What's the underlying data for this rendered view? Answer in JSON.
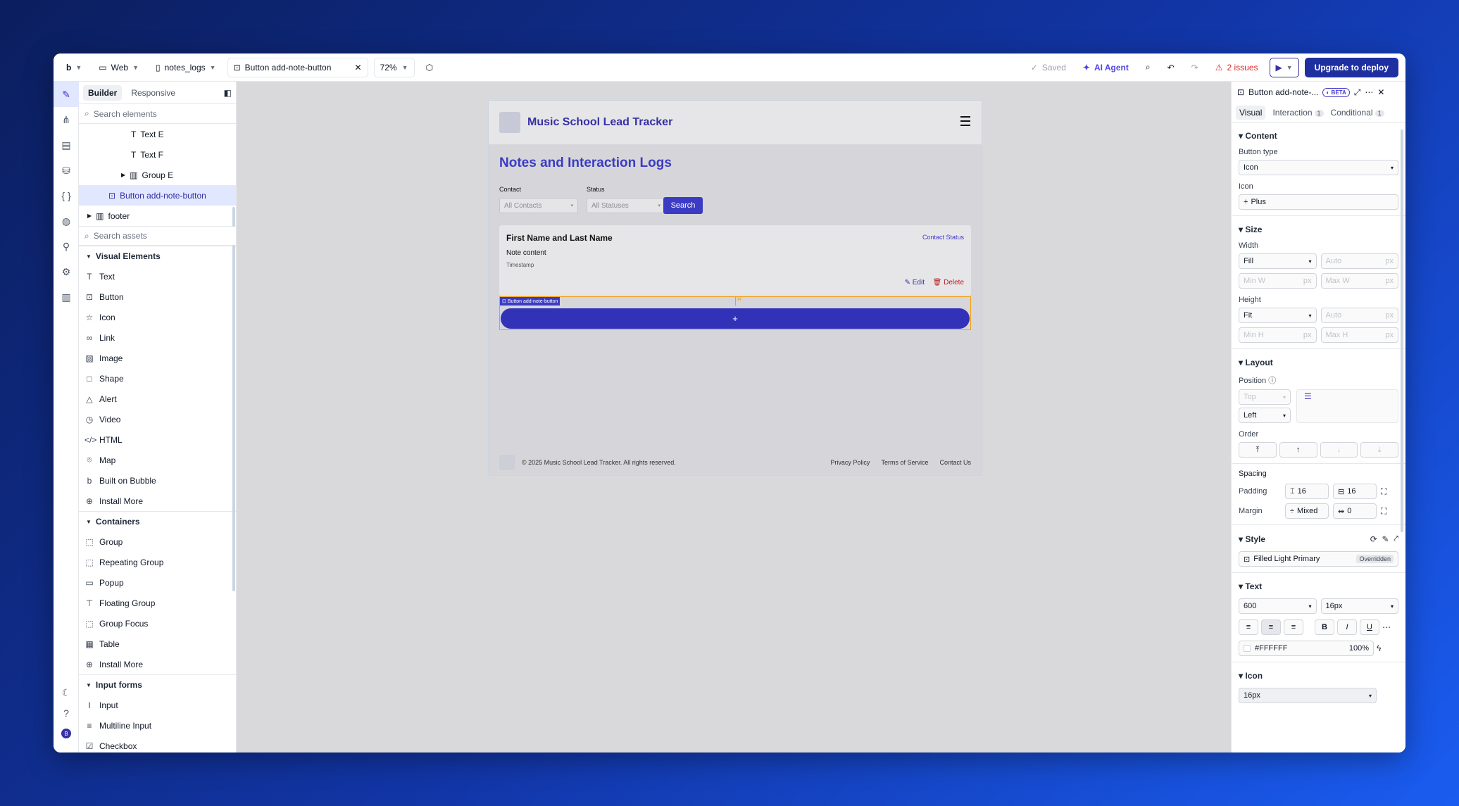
{
  "topbar": {
    "logo": "b",
    "platform": "Web",
    "page": "notes_logs",
    "element_tab": "Button add-note-button",
    "zoom": "72%",
    "saved": "Saved",
    "ai_agent": "AI Agent",
    "issues": "2 issues",
    "upgrade": "Upgrade to deploy"
  },
  "left": {
    "tabs": [
      "Builder",
      "Responsive"
    ],
    "search_elements": "Search elements",
    "tree": [
      {
        "label": "Text E"
      },
      {
        "label": "Text F"
      },
      {
        "label": "Group E"
      },
      {
        "label": "Button add-note-button"
      },
      {
        "label": "footer"
      }
    ],
    "search_assets": "Search assets",
    "visual_header": "Visual Elements",
    "visual": [
      "Text",
      "Button",
      "Icon",
      "Link",
      "Image",
      "Shape",
      "Alert",
      "Video",
      "HTML",
      "Map",
      "Built on Bubble",
      "Install More"
    ],
    "containers_header": "Containers",
    "containers": [
      "Group",
      "Repeating Group",
      "Popup",
      "Floating Group",
      "Group Focus",
      "Table",
      "Install More"
    ],
    "inputs_header": "Input forms",
    "inputs": [
      "Input",
      "Multiline Input",
      "Checkbox"
    ]
  },
  "canvas": {
    "app_title": "Music School Lead Tracker",
    "heading": "Notes and Interaction Logs",
    "contact_label": "Contact",
    "contact_value": "All Contacts",
    "status_label": "Status",
    "status_value": "All Statuses",
    "search_btn": "Search",
    "card": {
      "name": "First Name and Last Name",
      "status": "Contact Status",
      "note": "Note content",
      "timestamp": "Timestamp",
      "edit": "Edit",
      "delete": "Delete"
    },
    "selection_tag": "Button add-note-button",
    "selection_measure": "34",
    "plus": "+",
    "footer": {
      "copyright": "© 2025 Music School Lead Tracker. All rights reserved.",
      "links": [
        "Privacy Policy",
        "Terms of Service",
        "Contact Us"
      ]
    }
  },
  "right": {
    "title": "Button add-note-...",
    "beta": "BETA",
    "tabs": [
      {
        "label": "Visual",
        "count": ""
      },
      {
        "label": "Interaction",
        "count": "1"
      },
      {
        "label": "Conditional",
        "count": "1"
      }
    ],
    "content": {
      "header": "Content",
      "button_type_label": "Button type",
      "button_type": "Icon",
      "icon_label": "Icon",
      "icon": "Plus"
    },
    "size": {
      "header": "Size",
      "width_label": "Width",
      "width": "Fill",
      "auto": "Auto",
      "unit": "px",
      "min_w": "Min W",
      "max_w": "Max W",
      "height_label": "Height",
      "height": "Fit",
      "min_h": "Min H",
      "max_h": "Max H"
    },
    "layout": {
      "header": "Layout",
      "position_label": "Position",
      "top": "Top",
      "left": "Left",
      "order_label": "Order"
    },
    "spacing": {
      "header": "Spacing",
      "padding_label": "Padding",
      "padding_v": "16",
      "padding_h": "16",
      "margin_label": "Margin",
      "margin_v": "Mixed",
      "margin_h": "0"
    },
    "style": {
      "header": "Style",
      "value": "Filled Light Primary",
      "badge": "Overridden"
    },
    "text": {
      "header": "Text",
      "weight": "600",
      "size": "16px",
      "color": "#FFFFFF",
      "opacity": "100%"
    },
    "icon": {
      "header": "Icon",
      "size": "16px"
    }
  }
}
